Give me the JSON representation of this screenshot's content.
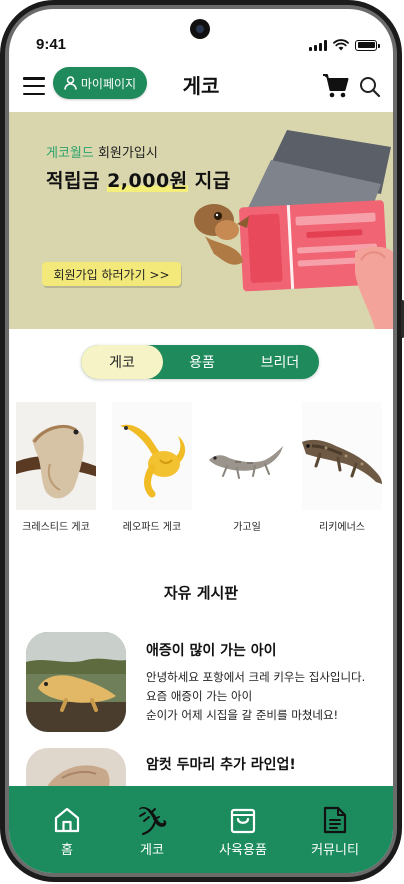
{
  "status_bar": {
    "time": "9:41"
  },
  "header": {
    "title": "게코",
    "mypage_label": "마이페이지"
  },
  "banner": {
    "line1_accent": "게코월드",
    "line1_rest": " 회원가입시",
    "line2_pre": "적립금 ",
    "line2_highlight": "2,000원",
    "line2_post": " 지급",
    "button_label": "회원가입 하러가기 >>"
  },
  "tabs": [
    {
      "label": "게코",
      "active": true
    },
    {
      "label": "용품",
      "active": false
    },
    {
      "label": "브리더",
      "active": false
    }
  ],
  "species": [
    {
      "label": "크레스티드 게코"
    },
    {
      "label": "레오파드 게코"
    },
    {
      "label": "가고일"
    },
    {
      "label": "리키에너스"
    }
  ],
  "board": {
    "title": "자유 게시판",
    "posts": [
      {
        "title": "애증이 많이 가는 아이",
        "lines": [
          "안녕하세요 포항에서 크레 키우는 집사입니다.",
          "요즘 애증이 가는 아이",
          "순이가 어제 시집을 갈 준비를 마쳤네요!"
        ]
      },
      {
        "title": "암컷 두마리 추가 라인업!",
        "lines": []
      }
    ]
  },
  "bottom_nav": [
    {
      "label": "홈",
      "icon": "home-icon"
    },
    {
      "label": "게코",
      "icon": "gecko-icon"
    },
    {
      "label": "사육용품",
      "icon": "shopping-bag-icon"
    },
    {
      "label": "커뮤니티",
      "icon": "document-icon"
    }
  ],
  "colors": {
    "brand_green": "#1f8a5b",
    "banner_bg": "#d9d6ad",
    "tab_active": "#f6f4c7",
    "button_yellow": "#f3e97a"
  }
}
